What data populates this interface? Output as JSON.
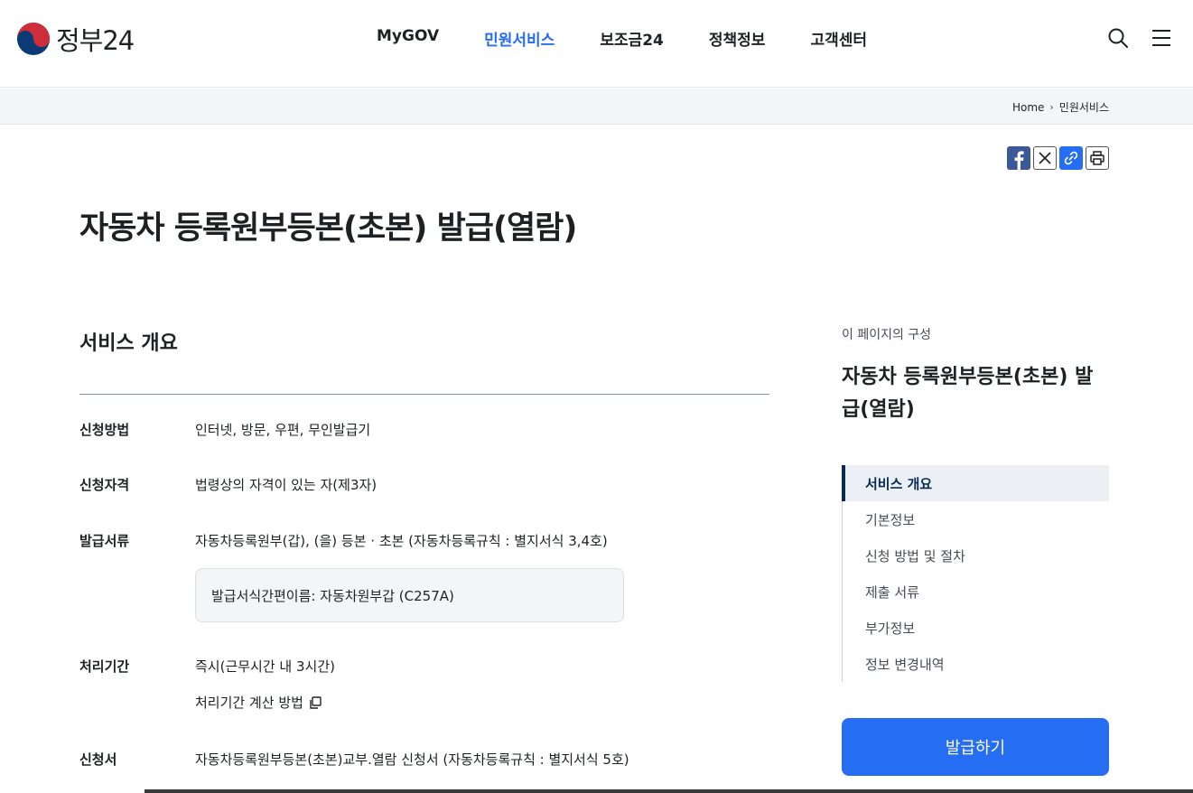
{
  "header": {
    "logo_text": "정부24",
    "nav": [
      "MyGOV",
      "민원서비스",
      "보조금24",
      "정책정보",
      "고객센터"
    ],
    "active_nav": "민원서비스"
  },
  "breadcrumb": {
    "home": "Home",
    "current": "민원서비스"
  },
  "page": {
    "title": "자동차 등록원부등본(초본) 발급(열람)"
  },
  "overview": {
    "section_title": "서비스 개요",
    "rows": {
      "method": {
        "label": "신청방법",
        "value": "인터넷, 방문, 우편, 무인발급기"
      },
      "eligibility": {
        "label": "신청자격",
        "value": "법령상의 자격이 있는 자(제3자)"
      },
      "documents": {
        "label": "발급서류",
        "value": "자동차등록원부(갑), (을) 등본 · 초본 (자동차등록규칙 : 별지서식 3,4호)"
      },
      "doc_note": "발급서식간편이름: 자동차원부갑 (C257A)",
      "period": {
        "label": "처리기간",
        "value": "즉시(근무시간 내 3시간)",
        "link": "처리기간 계산 방법"
      },
      "form": {
        "label": "신청서",
        "value": "자동차등록원부등본(초본)교부.열람 신청서 (자동차등록규칙 : 별지서식 5호)"
      }
    }
  },
  "toc": {
    "caption": "이 페이지의 구성",
    "title": "자동차 등록원부등본(초본) 발급(열람)",
    "items": [
      "서비스 개요",
      "기본정보",
      "신청 방법 및 절차",
      "제출 서류",
      "부가정보",
      "정보 변경내역"
    ],
    "active": "서비스 개요",
    "apply_button": "발급하기"
  },
  "colors": {
    "accent": "#256ef4",
    "toc_active": "#052b57"
  }
}
